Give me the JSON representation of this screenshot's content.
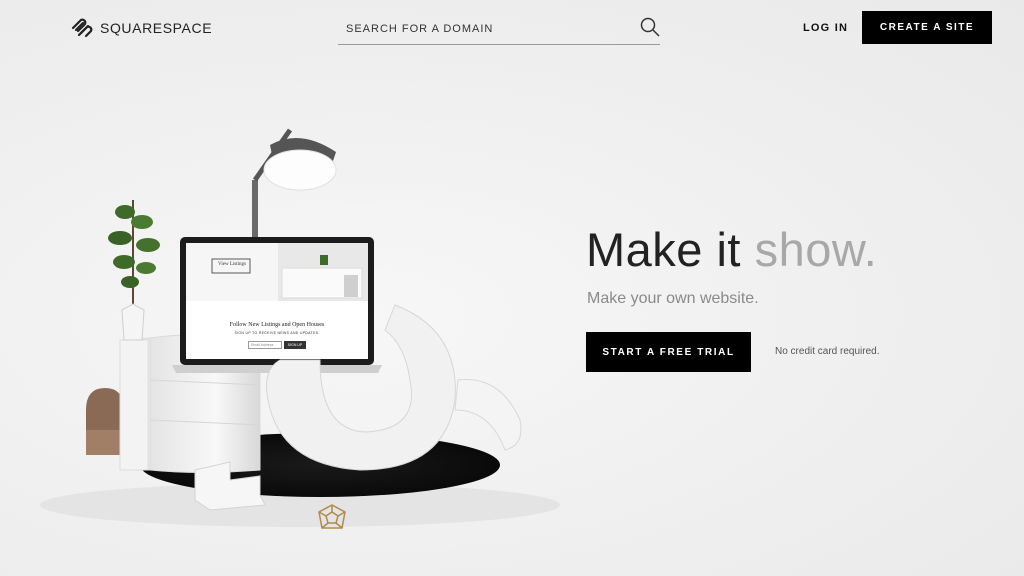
{
  "header": {
    "logo_text": "SQUARESPACE",
    "search_placeholder": "SEARCH FOR A DOMAIN",
    "login_label": "LOG IN",
    "create_label": "CREATE A SITE"
  },
  "hero": {
    "headline_main": "Make it",
    "headline_accent": "show.",
    "subtitle": "Make your own website.",
    "cta_label": "START A FREE TRIAL",
    "note": "No credit card required."
  },
  "laptop_screen": {
    "button_label": "View Listings",
    "heading": "Follow New Listings and Open Houses",
    "subheading": "SIGN UP TO RECEIVE NEWS AND UPDATES.",
    "email_placeholder": "Email Address",
    "signup_label": "SIGN UP"
  },
  "colors": {
    "accent_gray": "#a8a8a8",
    "button_black": "#000000",
    "background": "#efefef"
  },
  "icons": [
    "squarespace-logo-icon",
    "search-icon",
    "lamp",
    "plant",
    "laptop",
    "geometric-ornament"
  ]
}
